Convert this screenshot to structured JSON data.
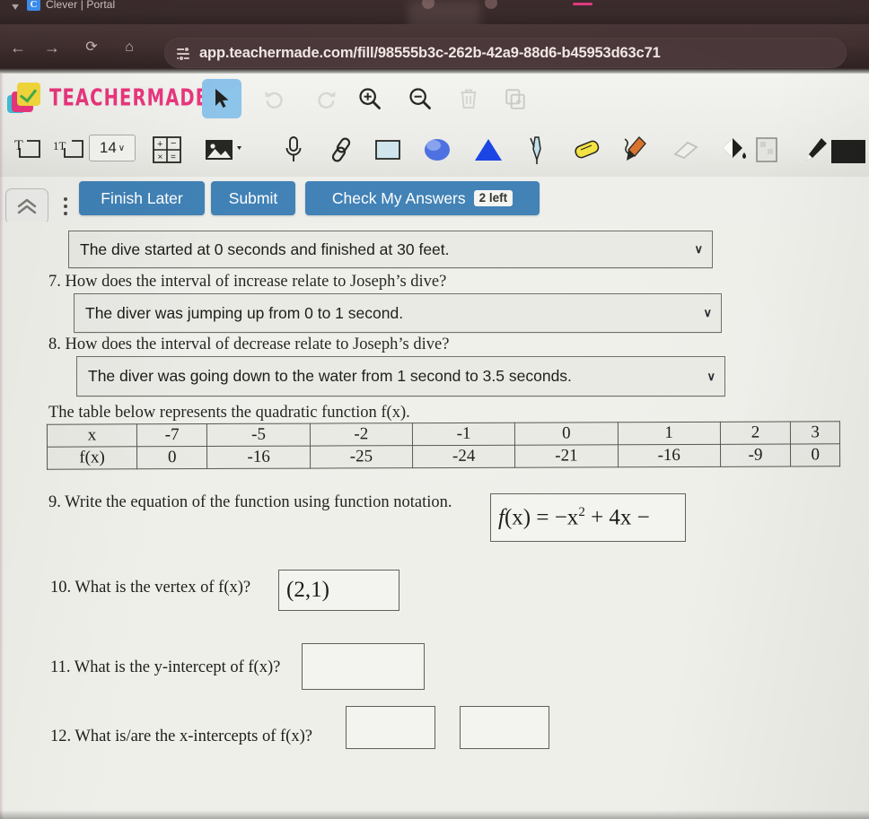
{
  "browser": {
    "tab_title": "Clever | Portal",
    "tab_favicon_letter": "C",
    "url": "app.teachermade.com/fill/98555b3c-262b-42a9-88d6-b45953d63c71",
    "nav": {
      "back": "←",
      "forward": "→",
      "reload": "⟳",
      "home": "⌂"
    }
  },
  "app": {
    "brand": "TEACHERMADE",
    "toolbar_primary": [
      {
        "name": "select-cursor-tool",
        "label": "Select",
        "active": true
      },
      {
        "name": "undo-tool",
        "label": "Undo",
        "active": false
      },
      {
        "name": "redo-tool",
        "label": "Redo",
        "active": false
      },
      {
        "name": "zoom-in-tool",
        "label": "Zoom In",
        "active": false
      },
      {
        "name": "zoom-out-tool",
        "label": "Zoom Out",
        "active": false
      },
      {
        "name": "delete-tool",
        "label": "Delete",
        "active": false
      },
      {
        "name": "duplicate-tool",
        "label": "Duplicate",
        "active": false
      }
    ],
    "toolbar_secondary": [
      {
        "name": "text-box-tool",
        "label": "Text Box"
      },
      {
        "name": "rich-text-tool",
        "label": "Rich Text"
      },
      {
        "name": "font-size-select",
        "label": "14"
      },
      {
        "name": "math-equation-tool",
        "label": "Math"
      },
      {
        "name": "image-tool",
        "label": "Image"
      },
      {
        "name": "audio-record-tool",
        "label": "Audio"
      },
      {
        "name": "link-tool",
        "label": "Link"
      },
      {
        "name": "rectangle-tool",
        "label": "Rectangle"
      },
      {
        "name": "ellipse-tool",
        "label": "Ellipse"
      },
      {
        "name": "triangle-tool",
        "label": "Triangle"
      },
      {
        "name": "pen-tool",
        "label": "Pen"
      },
      {
        "name": "highlighter-tool",
        "label": "Highlighter"
      },
      {
        "name": "marker-tool",
        "label": "Marker"
      },
      {
        "name": "eraser-tool",
        "label": "Eraser"
      },
      {
        "name": "fill-color-tool",
        "label": "Fill Color"
      },
      {
        "name": "stroke-color-tool",
        "label": "Stroke Color"
      }
    ],
    "font_size": "14",
    "font_size_caret": "∨"
  },
  "actions": {
    "collapse_label": "«",
    "finish_later": "Finish Later",
    "submit": "Submit",
    "check_my_answers": "Check My Answers",
    "checks_left_badge": "2 left",
    "button_color": "#3d7fb4"
  },
  "worksheet": {
    "answer_q6": {
      "value": "The dive started at 0 seconds and finished at 30 feet.",
      "caret": "∨"
    },
    "q7": {
      "number_text": "7.  How does the interval of increase relate to Joseph’s dive?",
      "answer": "The diver was jumping up from 0 to 1 second.",
      "caret": "∨"
    },
    "q8": {
      "number_text": "8.  How does the interval of decrease relate to Joseph’s dive?",
      "answer": "The diver was going down to the water from 1 second to 3.5 seconds.",
      "caret": "∨"
    },
    "table_intro": "The table below represents the quadratic function f(x).",
    "q9": {
      "number_text": "9.  Write the equation of the function using function notation.",
      "answer_prefix": "f",
      "answer_mid": "(x) = −x",
      "answer_exp": "2",
      "answer_suffix": " + 4x −"
    },
    "q10": {
      "number_text": "10. What is the vertex of f(x)?",
      "answer": "(2,1)"
    },
    "q11": {
      "number_text": "11. What is the y-intercept of f(x)?",
      "answer": ""
    },
    "q12": {
      "number_text": "12.  What is/are the x-intercepts of f(x)?",
      "answer_1": "",
      "answer_2": ""
    }
  },
  "chart_data": {
    "type": "table",
    "title": "The table below represents the quadratic function f(x).",
    "row_labels": [
      "x",
      "f(x)"
    ],
    "x": [
      -7,
      -5,
      -2,
      -1,
      0,
      1,
      2,
      3
    ],
    "fx": [
      0,
      -16,
      -25,
      -24,
      -21,
      -16,
      -9,
      0
    ],
    "rows": [
      [
        "x",
        "-7",
        "-5",
        "-2",
        "-1",
        "0",
        "1",
        "2",
        "3"
      ],
      [
        "f(x)",
        "0",
        "-16",
        "-25",
        "-24",
        "-21",
        "-16",
        "-9",
        "0"
      ]
    ]
  }
}
